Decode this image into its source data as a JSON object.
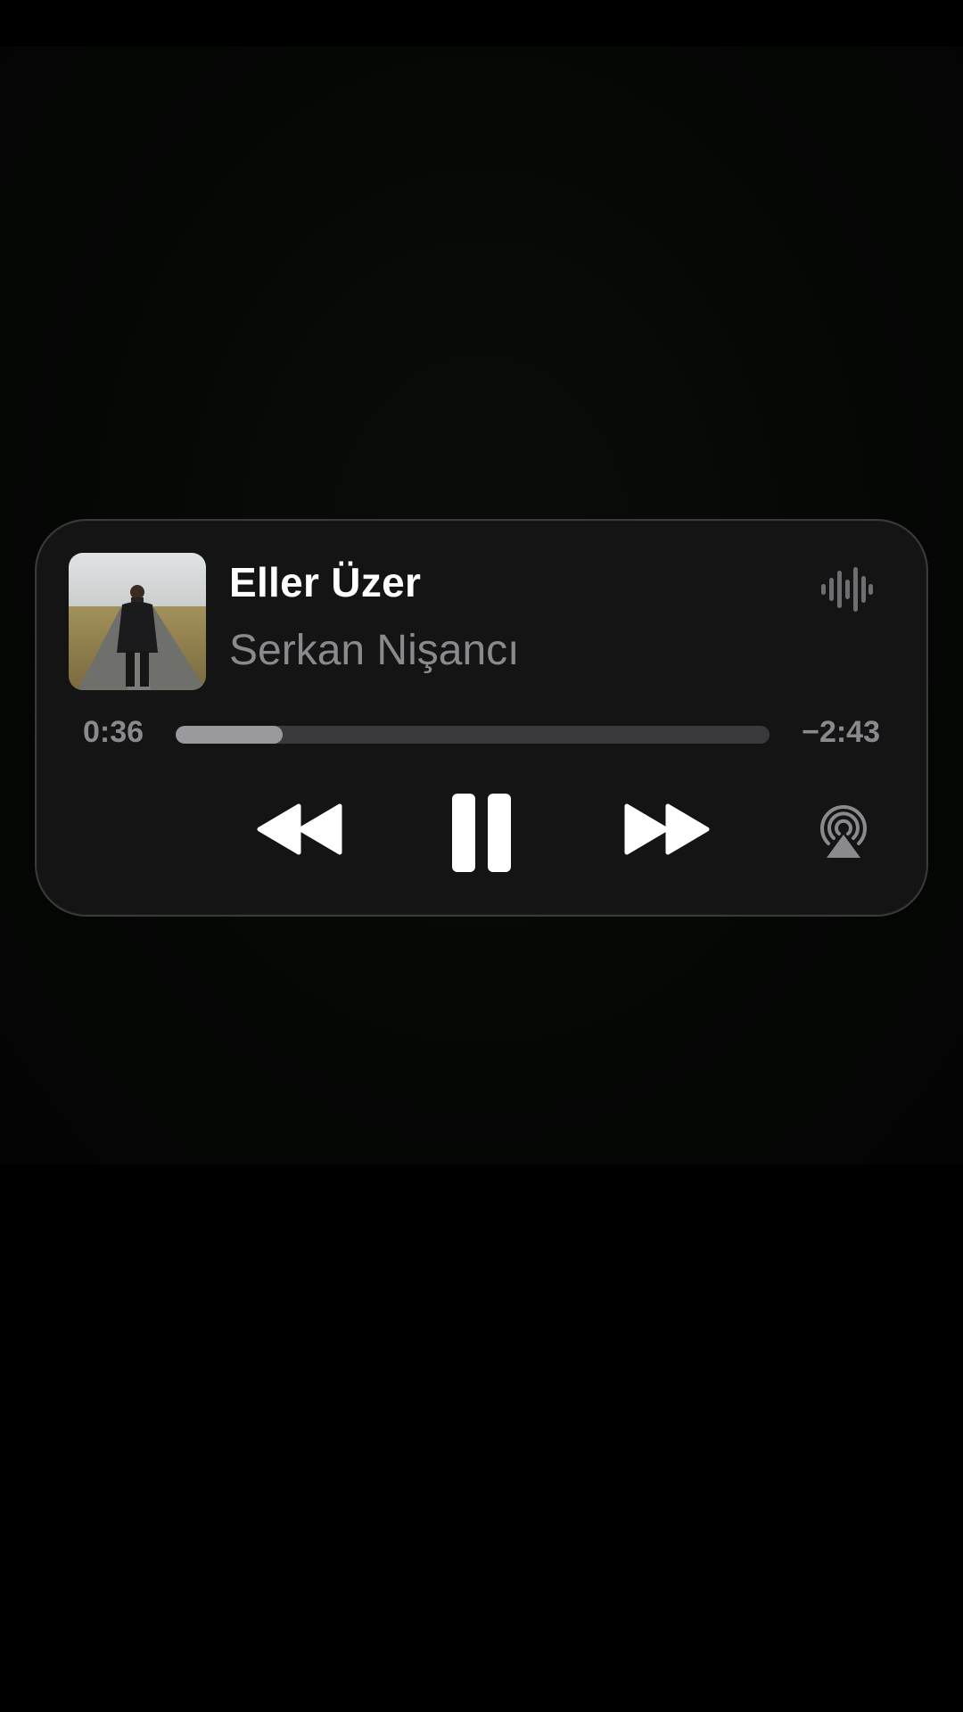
{
  "track": {
    "title": "Eller Üzer",
    "artist": "Serkan Nişancı"
  },
  "progress": {
    "elapsed": "0:36",
    "remaining": "−2:43",
    "fraction": 0.18
  },
  "controls": {
    "rewind_icon": "rewind-icon",
    "pause_icon": "pause-icon",
    "forward_icon": "fast-forward-icon",
    "airplay_icon": "airplay-icon",
    "waveform_icon": "waveform-icon"
  },
  "colors": {
    "background": "#000000",
    "card": "#141414",
    "title": "#ffffff",
    "secondary": "#8a8a8e",
    "progress_track": "#3a3a3c",
    "progress_fill": "#9a9a9e"
  }
}
